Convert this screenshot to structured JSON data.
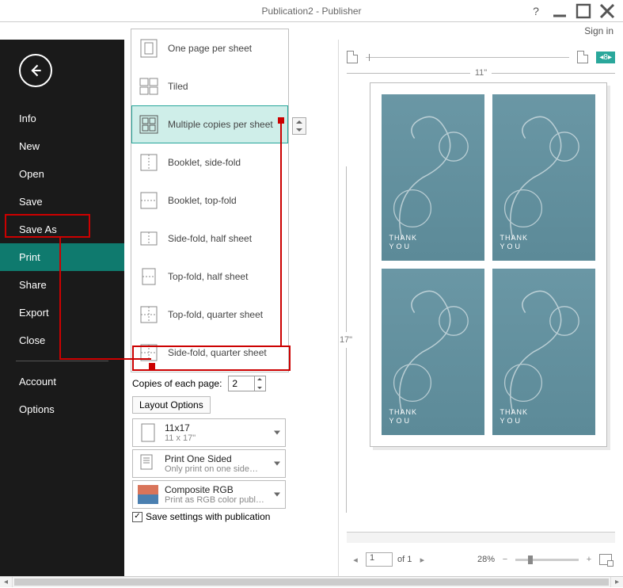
{
  "window": {
    "title": "Publication2 - Publisher",
    "help_icon": "?",
    "signin": "Sign in"
  },
  "sidebar": {
    "items": [
      "Info",
      "New",
      "Open",
      "Save",
      "Save As",
      "Print",
      "Share",
      "Export",
      "Close"
    ],
    "lower": [
      "Account",
      "Options"
    ],
    "active_index": 5
  },
  "dropdown": {
    "items": [
      "One page per sheet",
      "Tiled",
      "Multiple copies per sheet",
      "Booklet, side-fold",
      "Booklet, top-fold",
      "Side-fold, half sheet",
      "Top-fold, half sheet",
      "Top-fold, quarter sheet",
      "Side-fold, quarter sheet"
    ],
    "hovered_index": 2,
    "selected_label": "Multiple copies per sh…"
  },
  "settings": {
    "copies_label": "Copies of each page:",
    "copies_value": "2",
    "layout_options": "Layout Options",
    "paper": {
      "title": "11x17",
      "sub": "11 x 17\""
    },
    "sides": {
      "title": "Print One Sided",
      "sub": "Only print on one side…"
    },
    "color": {
      "title": "Composite RGB",
      "sub": "Print as RGB color publ…"
    },
    "save_checkbox": "Save settings with publication",
    "save_checked": true
  },
  "preview": {
    "badge": "8",
    "width_label": "11\"",
    "height_label": "17\"",
    "card_text_l1": "THANK",
    "card_text_l2": "YOU",
    "page_current": "1",
    "page_total": "of 1",
    "zoom": "28%"
  }
}
